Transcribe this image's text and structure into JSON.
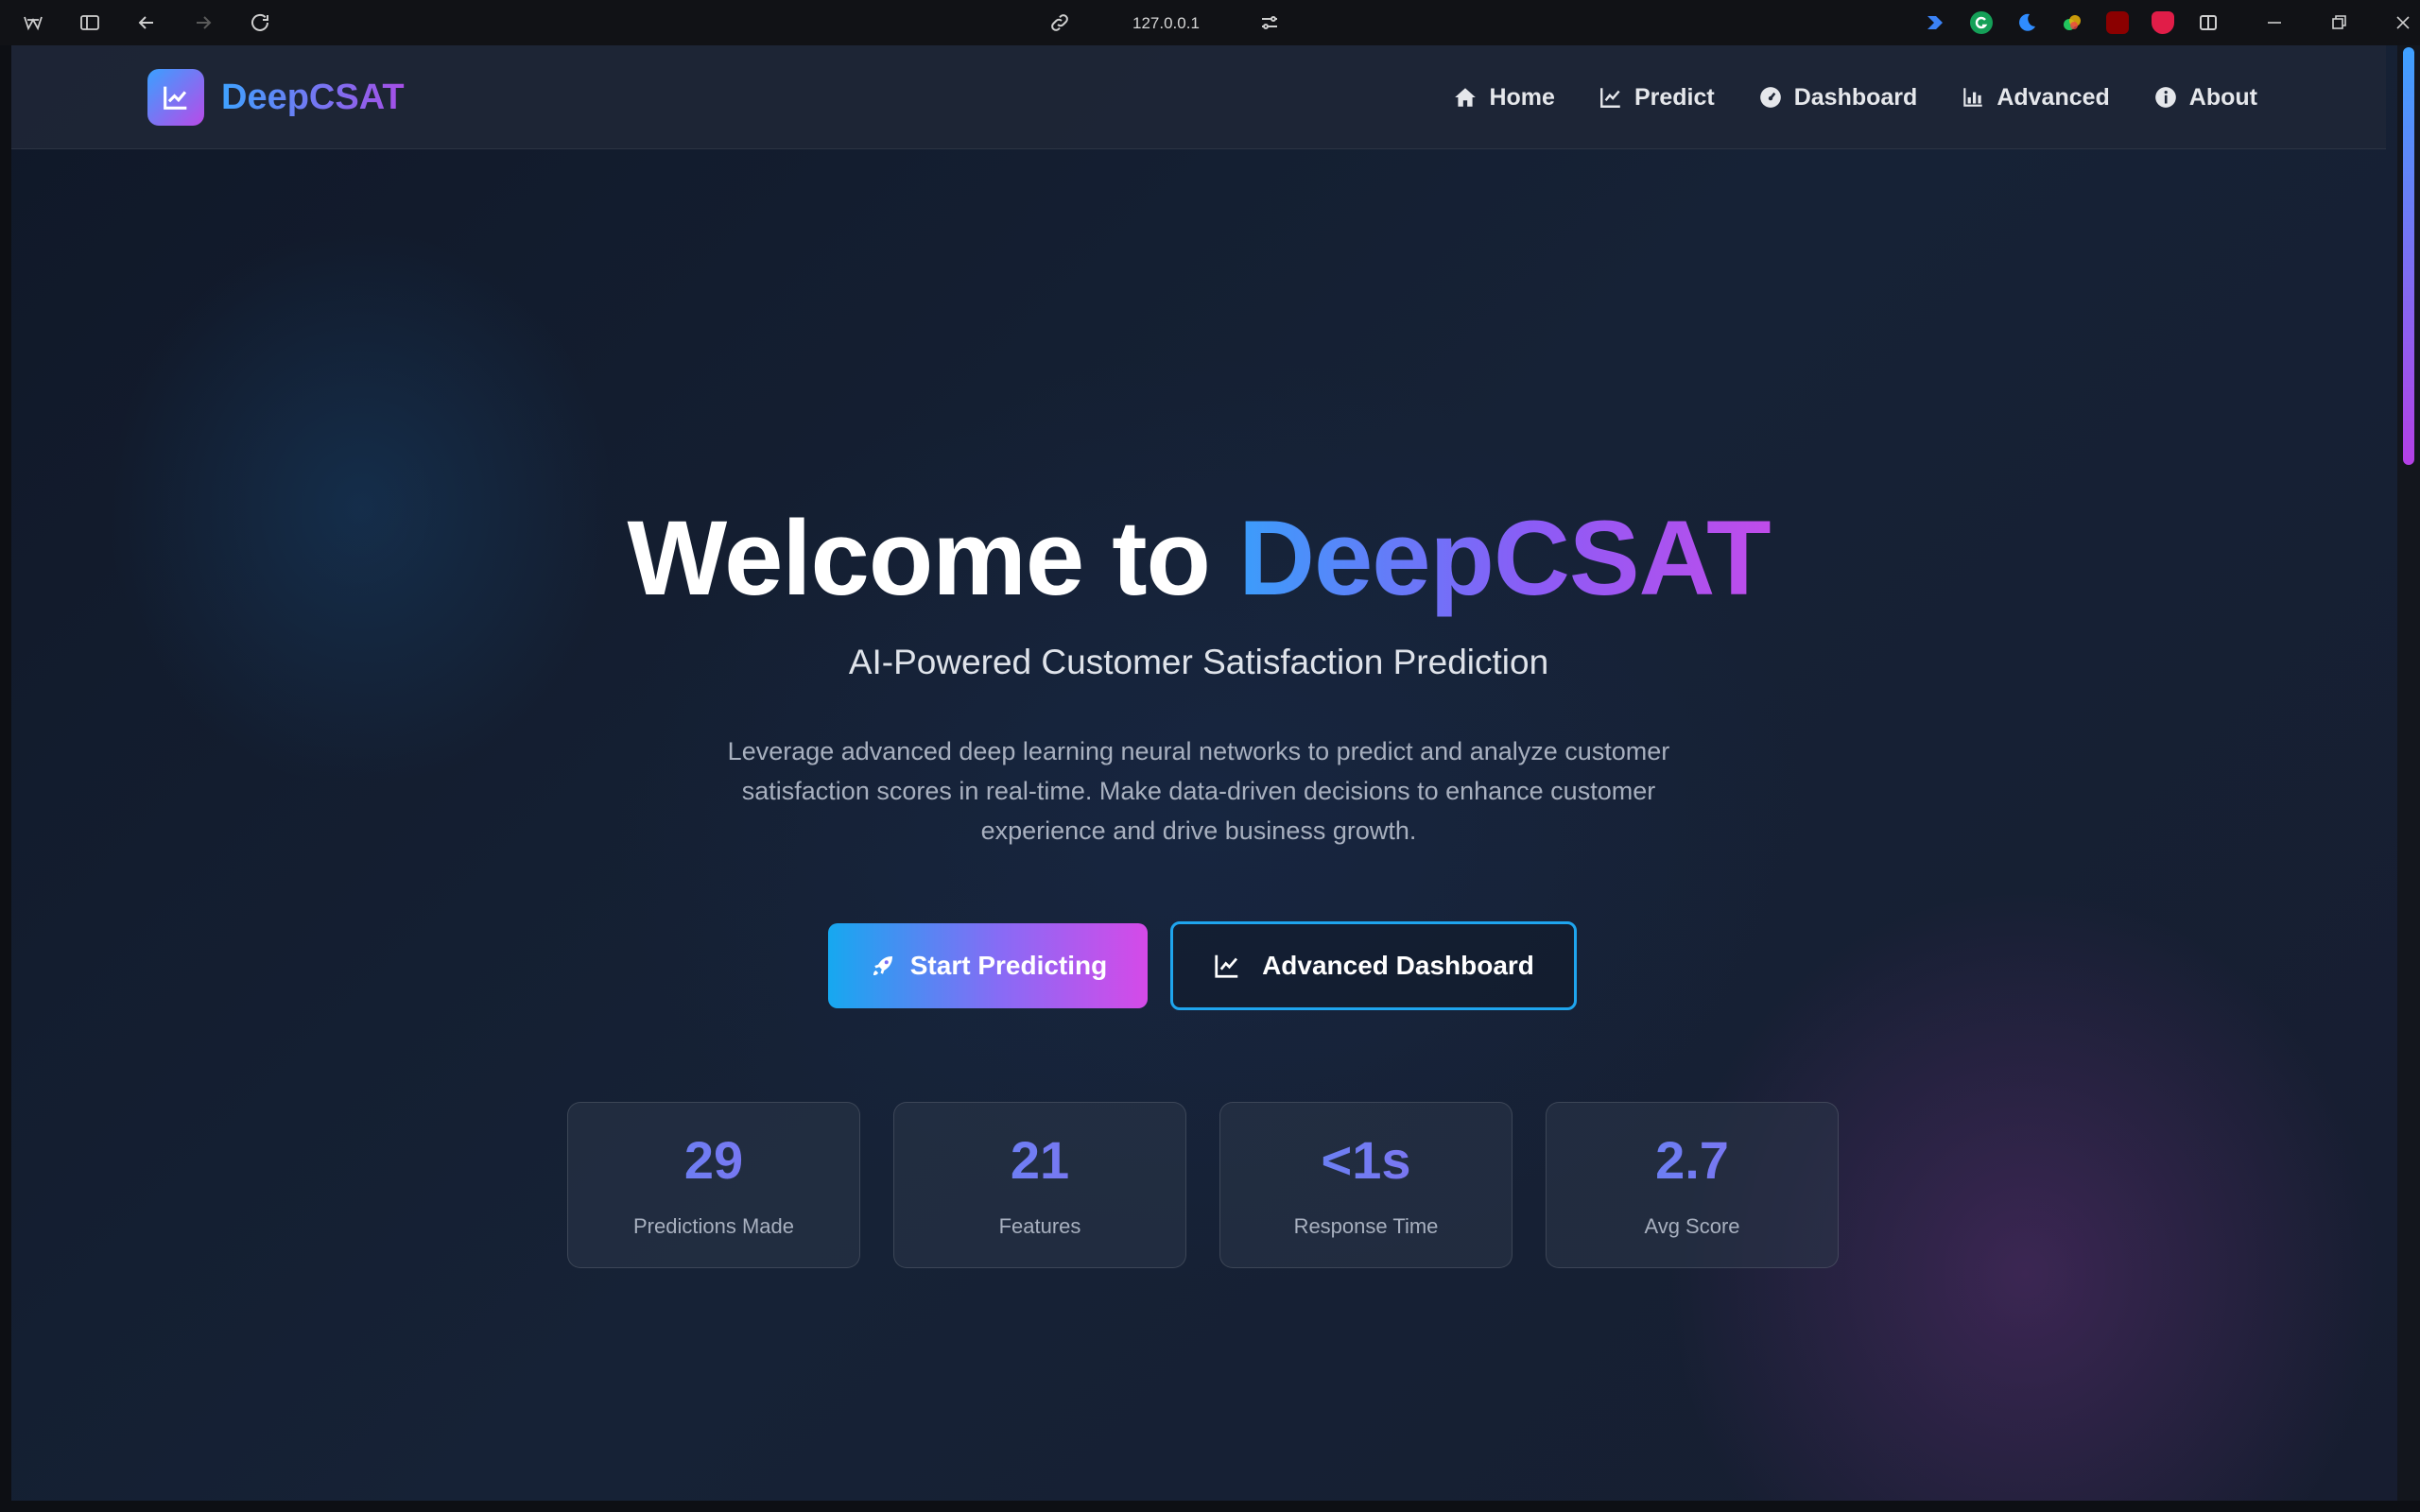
{
  "browser": {
    "url": "127.0.0.1"
  },
  "brand": {
    "name": "DeepCSAT"
  },
  "nav": {
    "items": [
      {
        "label": "Home",
        "icon": "home-icon"
      },
      {
        "label": "Predict",
        "icon": "chart-line-icon"
      },
      {
        "label": "Dashboard",
        "icon": "gauge-icon"
      },
      {
        "label": "Advanced",
        "icon": "chart-bar-icon"
      },
      {
        "label": "About",
        "icon": "info-icon"
      }
    ]
  },
  "hero": {
    "title_prefix": "Welcome to ",
    "title_highlight": "DeepCSAT",
    "subtitle": "AI-Powered Customer Satisfaction Prediction",
    "description": "Leverage advanced deep learning neural networks to predict and analyze customer satisfaction scores in real-time. Make data-driven decisions to enhance customer experience and drive business growth."
  },
  "buttons": {
    "primary": {
      "label": "Start Predicting",
      "icon": "rocket-icon"
    },
    "secondary": {
      "label": "Advanced Dashboard",
      "icon": "chart-line-icon"
    }
  },
  "stats": [
    {
      "value": "29",
      "label": "Predictions Made"
    },
    {
      "value": "21",
      "label": "Features"
    },
    {
      "value": "<1s",
      "label": "Response Time"
    },
    {
      "value": "2.7",
      "label": "Avg Score"
    }
  ],
  "colors": {
    "accent_blue": "#3b9dfb",
    "accent_purple": "#c04cea",
    "background": "#101828"
  }
}
